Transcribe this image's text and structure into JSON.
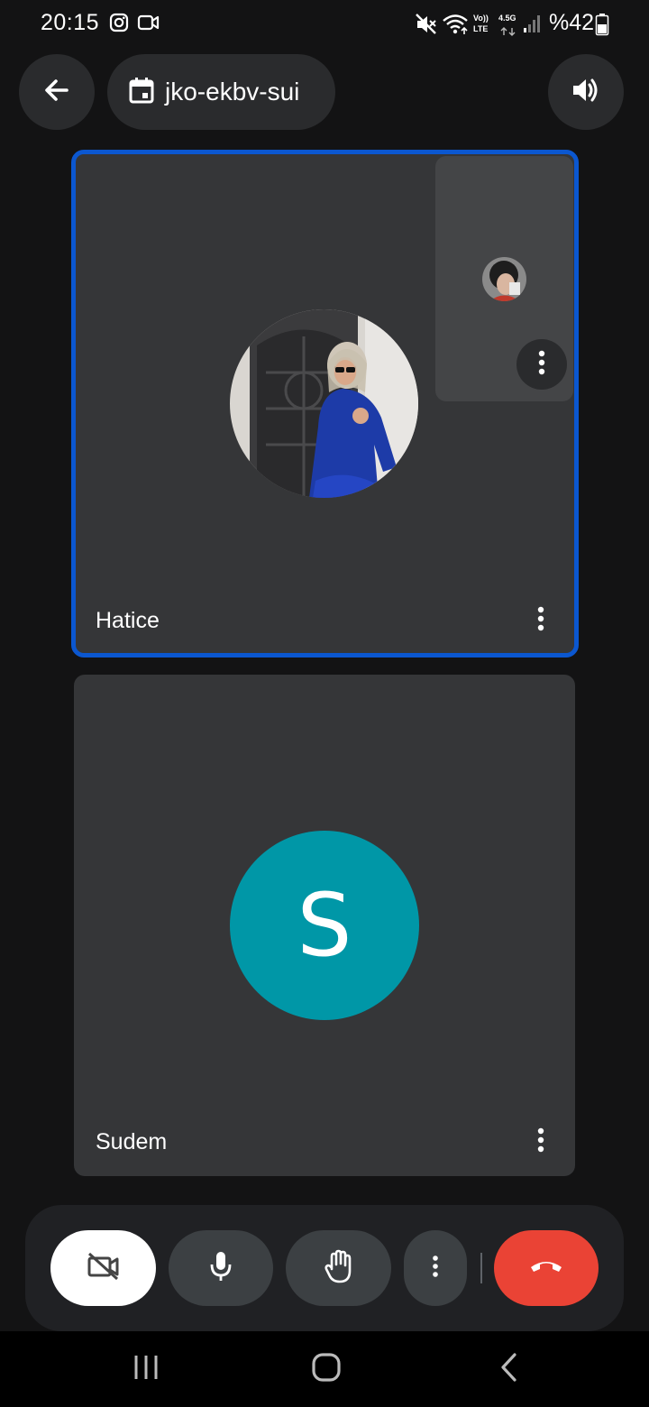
{
  "status_bar": {
    "time": "20:15",
    "network_label_top": "Vo))",
    "network_label_bottom": "LTE",
    "gen_label": "4.5G",
    "battery": "%42",
    "icons": [
      "instagram-icon",
      "video-call-icon",
      "mute-icon",
      "wifi-icon",
      "signal-icon",
      "battery-icon"
    ]
  },
  "top_bar": {
    "back_icon": "arrow-left-icon",
    "meeting_icon": "calendar-icon",
    "meeting_code": "jko-ekbv-sui",
    "audio_icon": "speaker-icon"
  },
  "participants": [
    {
      "name": "Hatice",
      "avatar": "photo",
      "active_speaker": true
    },
    {
      "name": "Sudem",
      "avatar_letter": "S",
      "avatar_color": "#0097a7"
    }
  ],
  "self_view": {
    "avatar": "photo",
    "menu_icon": "more-vert-icon"
  },
  "controls": {
    "camera": {
      "icon": "camera-off-icon",
      "state": "off"
    },
    "mic": {
      "icon": "mic-icon",
      "state": "on"
    },
    "raise_hand": {
      "icon": "hand-icon"
    },
    "more": {
      "icon": "more-vert-icon"
    },
    "end_call": {
      "icon": "call-end-icon",
      "color": "#ea4335"
    }
  },
  "nav_bar": [
    "recent-apps-icon",
    "home-icon",
    "back-icon"
  ],
  "colors": {
    "background": "#131314",
    "tile": "#353638",
    "active_border": "#0b57d0",
    "end_call": "#ea4335"
  }
}
